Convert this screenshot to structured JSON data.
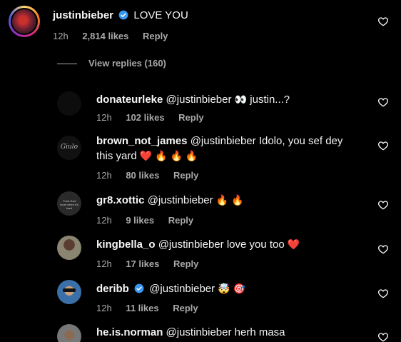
{
  "main": {
    "username": "justinbieber",
    "text": "LOVE YOU",
    "time": "12h",
    "likes": "2,814 likes",
    "reply": "Reply",
    "view_replies": "View replies (160)"
  },
  "replies": [
    {
      "username": "donateurleke",
      "mention": "@justinbieber",
      "text": "justin...?",
      "emoji": "👀",
      "time": "12h",
      "likes": "102 likes",
      "reply": "Reply",
      "avatar_color": "#0d0d0d"
    },
    {
      "username": "brown_not_james",
      "mention": "@justinbieber",
      "text": "Idolo, you sef dey",
      "text2": "this yard",
      "emoji": "❤️ 🔥 🔥 🔥",
      "time": "12h",
      "likes": "80 likes",
      "reply": "Reply",
      "avatar_color": "#111111",
      "avatar_text": "Giulo"
    },
    {
      "username": "gr8.xottic",
      "mention": "@justinbieber",
      "text": "",
      "emoji": "🔥 🔥",
      "time": "12h",
      "likes": "9 likes",
      "reply": "Reply",
      "avatar_color": "#2a2a2a",
      "avatar_text": "Trust God more when it's hard"
    },
    {
      "username": "kingbella_o",
      "mention": "@justinbieber",
      "text": "love you too",
      "emoji": "❤️",
      "time": "12h",
      "likes": "17 likes",
      "reply": "Reply",
      "avatar_color": "#6e6a5c"
    },
    {
      "username": "deribb",
      "mention": "@justinbieber",
      "text": "",
      "emoji": "🤯 🎯",
      "time": "12h",
      "likes": "11 likes",
      "reply": "Reply",
      "avatar_color": "#3a6fa8"
    },
    {
      "username": "he.is.norman",
      "mention": "@justinbieber",
      "text": "herh masa",
      "emoji": "",
      "time": "",
      "likes": "",
      "reply": "",
      "avatar_color": "#777777"
    }
  ],
  "colors": {
    "verified": "#3897f0",
    "muted": "#a8a8a8",
    "accent_story": "#d62976"
  },
  "icons": [
    "heart-outline-icon",
    "verified-badge-icon"
  ]
}
